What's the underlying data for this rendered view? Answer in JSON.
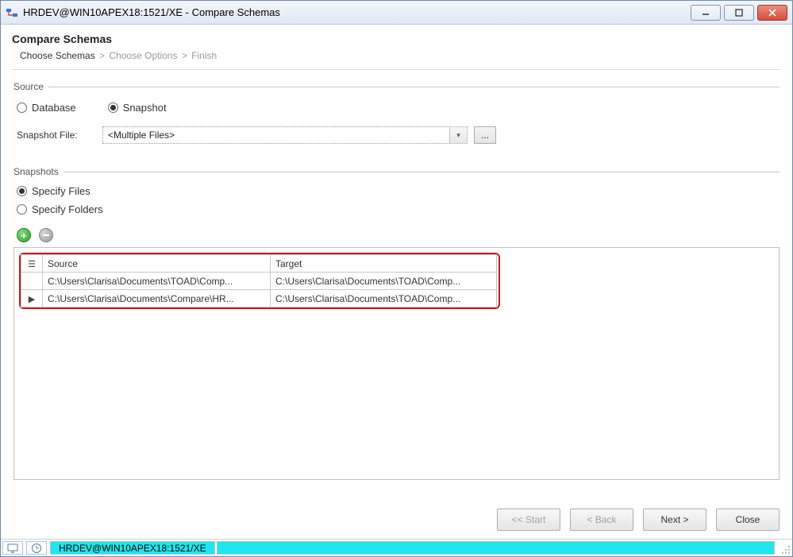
{
  "window": {
    "title": "HRDEV@WIN10APEX18:1521/XE - Compare Schemas"
  },
  "header": {
    "title": "Compare Schemas",
    "breadcrumb": {
      "step1": "Choose Schemas",
      "step2": "Choose Options",
      "step3": "Finish"
    }
  },
  "source_section": {
    "legend": "Source",
    "radio_database": "Database",
    "radio_snapshot": "Snapshot",
    "snapshot_file_label": "Snapshot File:",
    "snapshot_file_value": "<Multiple Files>",
    "browse_label": "..."
  },
  "snapshots_section": {
    "legend": "Snapshots",
    "radio_files": "Specify Files",
    "radio_folders": "Specify Folders"
  },
  "grid": {
    "col_source": "Source",
    "col_target": "Target",
    "rows": [
      {
        "source": "C:\\Users\\Clarisa\\Documents\\TOAD\\Comp...",
        "target": "C:\\Users\\Clarisa\\Documents\\TOAD\\Comp..."
      },
      {
        "source": "C:\\Users\\Clarisa\\Documents\\Compare\\HR...",
        "target": "C:\\Users\\Clarisa\\Documents\\TOAD\\Comp..."
      }
    ]
  },
  "buttons": {
    "start": "<< Start",
    "back": "< Back",
    "next": "Next >",
    "close": "Close"
  },
  "status": {
    "connection": "HRDEV@WIN10APEX18:1521/XE"
  }
}
